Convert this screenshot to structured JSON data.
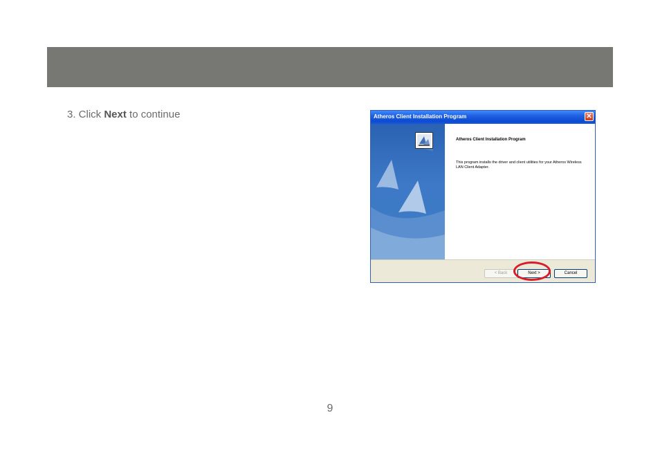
{
  "header": {},
  "instruction": {
    "prefix": "3. Click ",
    "emphasis": "Next",
    "suffix": " to continue"
  },
  "page_number": "9",
  "dialog": {
    "title": "Atheros Client Installation Program",
    "close_glyph": "✕",
    "heading": "Atheros Client Installation Program",
    "description": "This program installs the driver and client utilities for your Atheros Wireless LAN Client Adapter.",
    "buttons": {
      "back": "< Back",
      "next": "Next >",
      "cancel": "Cancel"
    },
    "icon": "installer-icon"
  },
  "colors": {
    "header_bar": "#777874",
    "highlight": "#d81e2a",
    "titlebar": "#0b4bd4"
  }
}
